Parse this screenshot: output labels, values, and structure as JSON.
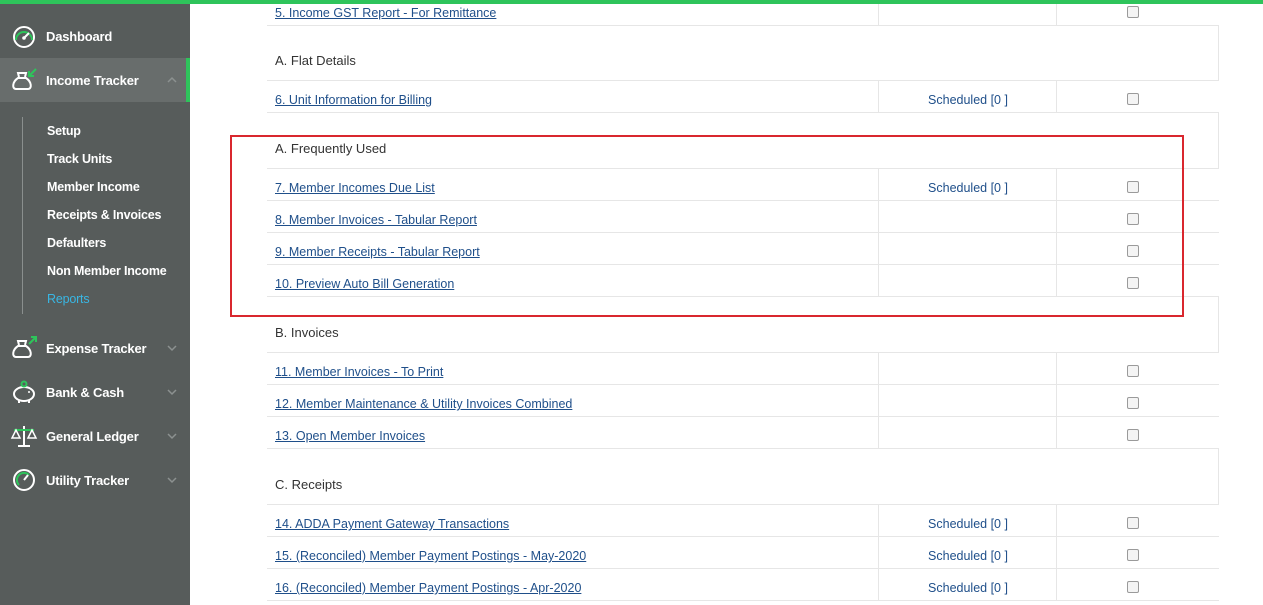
{
  "colors": {
    "accent": "#2ec45b",
    "sidebar_bg": "#575c5b",
    "link": "#1f4f8a",
    "active_sub": "#39b6e3",
    "highlight": "#d9272e"
  },
  "sidebar": {
    "items": [
      {
        "label": "Dashboard",
        "icon": "speedometer-icon"
      },
      {
        "label": "Income Tracker",
        "icon": "money-bag-in-icon"
      },
      {
        "label": "Expense Tracker",
        "icon": "money-bag-out-icon"
      },
      {
        "label": "Bank & Cash",
        "icon": "piggy-bank-icon"
      },
      {
        "label": "General Ledger",
        "icon": "scales-icon"
      },
      {
        "label": "Utility Tracker",
        "icon": "gauge-icon"
      }
    ],
    "sub_items": [
      "Setup",
      "Track Units",
      "Member Income",
      "Receipts & Invoices",
      "Defaulters",
      "Non Member Income",
      "Reports"
    ]
  },
  "reports": {
    "top_row": {
      "link": "5. Income GST Report - For Remittance",
      "scheduled": ""
    },
    "sections": {
      "flat_details": "A. Flat Details",
      "frequently_used": "A. Frequently Used",
      "invoices": "B. Invoices",
      "receipts": "C. Receipts"
    },
    "flat_rows": [
      {
        "link": "6. Unit Information for Billing",
        "scheduled": "Scheduled [0 ]"
      }
    ],
    "frequent_rows": [
      {
        "link": "7. Member Incomes Due List",
        "scheduled": "Scheduled [0 ]"
      },
      {
        "link": "8. Member Invoices - Tabular Report",
        "scheduled": ""
      },
      {
        "link": "9. Member Receipts - Tabular Report",
        "scheduled": ""
      },
      {
        "link": "10. Preview Auto Bill Generation",
        "scheduled": ""
      }
    ],
    "invoice_rows": [
      {
        "link": "11. Member Invoices - To Print",
        "scheduled": ""
      },
      {
        "link": "12. Member Maintenance & Utility Invoices Combined",
        "scheduled": ""
      },
      {
        "link": "13. Open Member Invoices",
        "scheduled": ""
      }
    ],
    "receipt_rows": [
      {
        "link": "14. ADDA Payment Gateway Transactions",
        "scheduled": "Scheduled [0 ]"
      },
      {
        "link": "15. (Reconciled) Member Payment Postings - May-2020",
        "scheduled": "Scheduled [0 ]"
      },
      {
        "link": "16. (Reconciled) Member Payment Postings - Apr-2020",
        "scheduled": "Scheduled [0 ]"
      }
    ]
  }
}
